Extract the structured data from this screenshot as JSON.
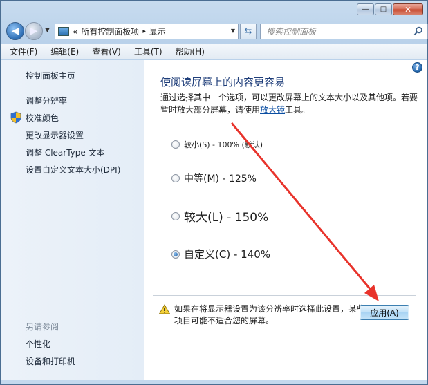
{
  "window": {
    "caption_buttons": {
      "minimize": "—",
      "maximize": "□",
      "close": "✕"
    }
  },
  "nav": {
    "address_prefix": "«",
    "breadcrumb_root": "所有控制面板项",
    "breadcrumb_sep": "▸",
    "breadcrumb_current": "显示",
    "search_placeholder": "搜索控制面板"
  },
  "menubar": {
    "items": [
      "文件(F)",
      "编辑(E)",
      "查看(V)",
      "工具(T)",
      "帮助(H)"
    ]
  },
  "sidebar": {
    "home": "控制面板主页",
    "links": [
      "调整分辨率",
      "校准颜色",
      "更改显示器设置",
      "调整 ClearType 文本",
      "设置自定义文本大小(DPI)"
    ],
    "see_also_title": "另请参阅",
    "see_also": [
      "个性化",
      "设备和打印机"
    ]
  },
  "main": {
    "title": "使阅读屏幕上的内容更容易",
    "desc_before": "通过选择其中一个选项，可以更改屏幕上的文本大小以及其他项。若要暂时放大部分屏幕，请使用",
    "desc_link": "放大镜",
    "desc_after": "工具。",
    "options": [
      {
        "label": "较小(S) - 100% (默认)",
        "checked": false
      },
      {
        "label": "中等(M) - 125%",
        "checked": false
      },
      {
        "label": "较大(L) - 150%",
        "checked": false
      },
      {
        "label": "自定义(C) - 140%",
        "checked": true
      }
    ],
    "warning": "如果在将显示器设置为该分辨率时选择此设置，某些项目可能不适合您的屏幕。",
    "apply_label": "应用(A)",
    "help_icon": "?"
  },
  "colors": {
    "title_blue": "#1f3e7a",
    "link_blue": "#0b4ea2",
    "annotation_red": "#e8332b"
  }
}
